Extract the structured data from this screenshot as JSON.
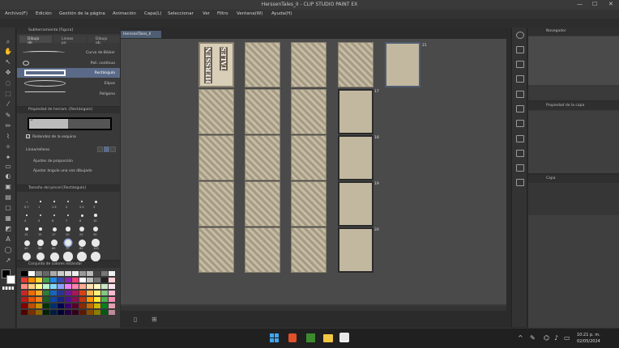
{
  "window": {
    "title": "HerssenTales_II - CLIP STUDIO PAINT EX",
    "min": "—",
    "max": "☐",
    "close": "✕"
  },
  "menu": [
    "Archivo(F)",
    "Edición",
    "Gestión de la página",
    "Animación",
    "Capa(L)",
    "Seleccionar",
    "Ver",
    "Filtro",
    "Ventana(W)",
    "Ayuda(H)"
  ],
  "subtool": {
    "header": "Subherramienta [Figura]",
    "tabs": [
      "Dibujo dir.",
      "Líneas po",
      "Dibujo ob."
    ],
    "items": [
      "Curva de Bézier",
      "Poli. contínuo",
      "Rectángulo",
      "Elipse",
      "Polígono"
    ]
  },
  "tool_property": {
    "header": "Propiedad de herram. [Rectángulo]",
    "brush_size": "1.5",
    "options": [
      "Redondez de la esquina",
      "Línea/relleno",
      "Ajustes de proporción",
      "Ajustar ángulo una vez dibujado"
    ]
  },
  "brush_size_panel": {
    "header": "Tamaño del pincel [Rectángulo]",
    "sizes": [
      "0.7",
      "1",
      "1.5",
      "2",
      "2.5",
      "3",
      "4",
      "5",
      "6",
      "7",
      "8",
      "10",
      "12",
      "15",
      "17",
      "20",
      "25",
      "30",
      "40",
      "50",
      "60",
      "70",
      "80",
      "100",
      "120",
      "150",
      "170",
      "200",
      "250",
      "300"
    ]
  },
  "color_panel": {
    "header": "Conjunto de colores estándar"
  },
  "document_tab": "HerssenTales_II",
  "cover_text": {
    "a": "HERSSEN",
    "b": "TALES"
  },
  "page_numbers": [
    "21",
    "17",
    "18",
    "19",
    "20"
  ],
  "navigator": {
    "header": "Navegador"
  },
  "layer_property": {
    "header": "Propiedad de la capa"
  },
  "layer": {
    "header": "Capa"
  },
  "clock": {
    "time": "10:21 p. m.",
    "date": "02/05/2024"
  },
  "colors": {
    "accent": "#4f5d73",
    "selected": "#5a6a88"
  }
}
